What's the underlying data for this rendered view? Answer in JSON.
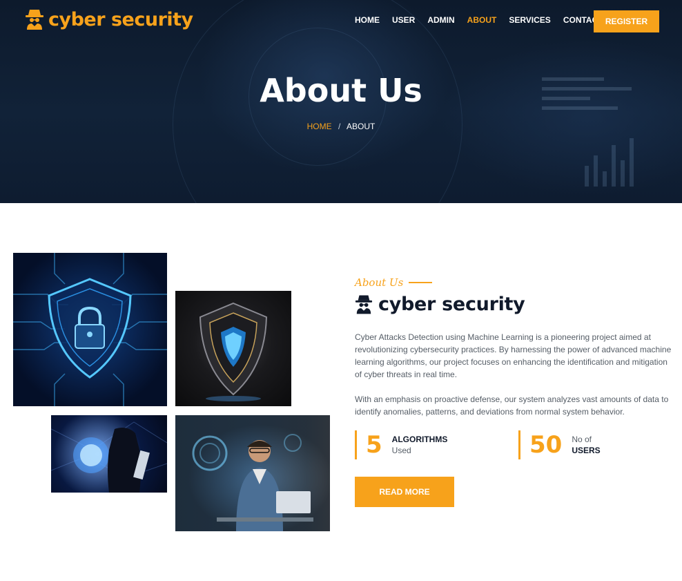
{
  "brand": {
    "name": "cyber security",
    "accent": "#f7a21b",
    "dark": "#111a2b",
    "icon": "spy-icon"
  },
  "nav": {
    "items": [
      "HOME",
      "USER",
      "ADMIN",
      "ABOUT",
      "SERVICES",
      "CONTACT"
    ],
    "active": "ABOUT",
    "register_label": "REGISTER"
  },
  "hero": {
    "title": "About Us",
    "breadcrumb": {
      "home": "HOME",
      "separator": "/",
      "current": "ABOUT"
    }
  },
  "about": {
    "subtitle": "About Us",
    "brand_name": "cyber security",
    "paragraphs": [
      "Cyber Attacks Detection using Machine Learning is a pioneering project aimed at revolutionizing cybersecurity practices. By harnessing the power of advanced machine learning algorithms, our project focuses on enhancing the identification and mitigation of cyber threats in real time.",
      "With an emphasis on proactive defense, our system analyzes vast amounts of data to identify anomalies, patterns, and deviations from normal system behavior."
    ],
    "stats": [
      {
        "number": "5",
        "label_top": "ALGORITHMS",
        "label_bottom": "Used"
      },
      {
        "number": "50",
        "label_top": "No of",
        "label_bottom": "USERS"
      }
    ],
    "read_more_label": "READ MORE"
  },
  "images": {
    "img1": "cyber-shield-lock-image",
    "img2": "dark-shield-image",
    "img3": "hooded-hacker-image",
    "img4": "man-with-laptop-image"
  }
}
